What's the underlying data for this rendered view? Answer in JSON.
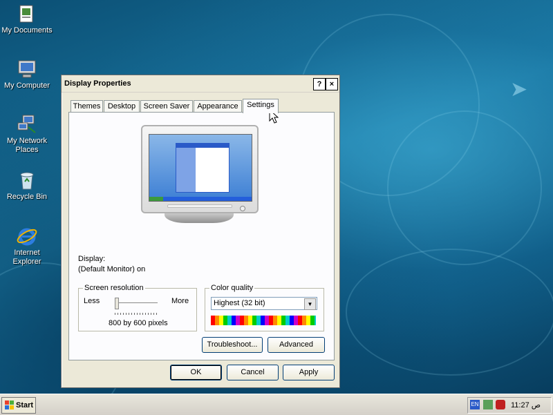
{
  "desktop": {
    "icons": [
      {
        "label": "My Documents",
        "icon": "my-documents-icon"
      },
      {
        "label": "My Computer",
        "icon": "my-computer-icon"
      },
      {
        "label": "My Network Places",
        "icon": "network-places-icon"
      },
      {
        "label": "Recycle Bin",
        "icon": "recycle-bin-icon"
      },
      {
        "label": "Internet Explorer",
        "icon": "internet-explorer-icon"
      }
    ]
  },
  "dialog": {
    "title": "Display Properties",
    "help_button": "?",
    "close_button": "×",
    "tabs": [
      "Themes",
      "Desktop",
      "Screen Saver",
      "Appearance",
      "Settings"
    ],
    "active_tab": "Settings",
    "display_label": "Display:",
    "display_value": "(Default Monitor) on",
    "screen_resolution": {
      "legend": "Screen resolution",
      "less_label": "Less",
      "more_label": "More",
      "value_text": "800 by 600 pixels",
      "slider_position": 0
    },
    "color_quality": {
      "legend": "Color quality",
      "selected": "Highest (32 bit)"
    },
    "buttons": {
      "troubleshoot": "Troubleshoot...",
      "advanced": "Advanced",
      "ok": "OK",
      "cancel": "Cancel",
      "apply": "Apply"
    }
  },
  "taskbar": {
    "start_label": "Start",
    "language": "EN",
    "clock": "11:27 ص"
  },
  "colors": {
    "desktop_bg": "#0d5f8a",
    "dialog_bg": "#ece9d8",
    "panel_bg": "#fcfcfe",
    "button_border": "#003c74"
  }
}
